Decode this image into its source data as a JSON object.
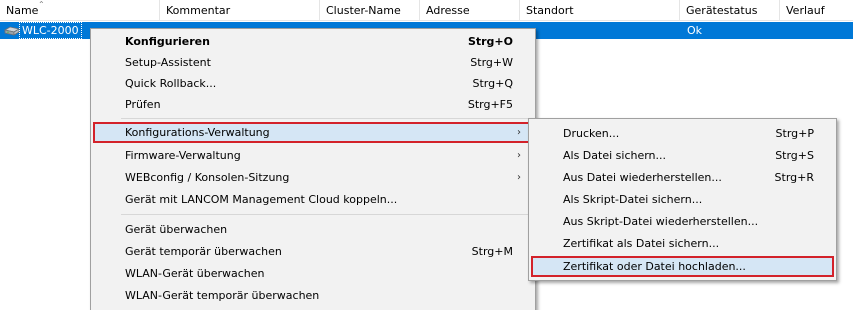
{
  "columns": [
    "Name",
    "Kommentar",
    "Cluster-Name",
    "Adresse",
    "Standort",
    "Gerätestatus",
    "Verlauf"
  ],
  "device": {
    "name": "WLC-2000",
    "status": "Ok",
    "icon": "router-device-icon"
  },
  "main_menu": {
    "items": [
      {
        "label": "Konfigurieren",
        "shortcut": "Strg+O"
      },
      {
        "label": "Setup-Assistent",
        "shortcut": "Strg+W"
      },
      {
        "label": "Quick Rollback...",
        "shortcut": "Strg+Q"
      },
      {
        "label": "Prüfen",
        "shortcut": "Strg+F5"
      },
      {
        "label": "Konfigurations-Verwaltung",
        "submenu": "›"
      },
      {
        "label": "Firmware-Verwaltung",
        "submenu": "›"
      },
      {
        "label": "WEBconfig / Konsolen-Sitzung",
        "submenu": "›"
      },
      {
        "label": "Gerät mit LANCOM Management Cloud koppeln..."
      },
      {
        "label": "Gerät überwachen"
      },
      {
        "label": "Gerät temporär überwachen",
        "shortcut": "Strg+M"
      },
      {
        "label": "WLAN-Gerät überwachen"
      },
      {
        "label": "WLAN-Gerät temporär überwachen"
      }
    ]
  },
  "sub_menu": {
    "items": [
      {
        "label": "Drucken...",
        "shortcut": "Strg+P"
      },
      {
        "label": "Als Datei sichern...",
        "shortcut": "Strg+S"
      },
      {
        "label": "Aus Datei wiederherstellen...",
        "shortcut": "Strg+R"
      },
      {
        "label": "Als Skript-Datei sichern..."
      },
      {
        "label": "Aus Skript-Datei wiederherstellen..."
      },
      {
        "label": "Zertifikat als Datei sichern..."
      },
      {
        "label": "Zertifikat oder Datei hochladen..."
      }
    ]
  },
  "colors": {
    "selection": "#0078d7",
    "highlight_border": "#d3222a",
    "menu_background": "#f2f2f2"
  }
}
